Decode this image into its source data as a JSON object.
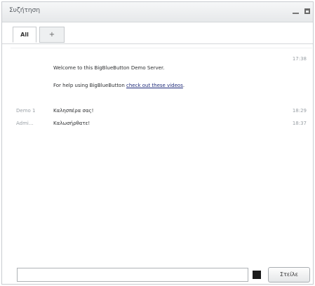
{
  "window": {
    "title": "Συζήτηση"
  },
  "tabs": [
    {
      "label": "All",
      "active": true
    },
    {
      "label": "+",
      "active": false
    }
  ],
  "messages": [
    {
      "name": "",
      "text": "",
      "time": "17:38"
    },
    {
      "name": "",
      "text": "Welcome to this BigBlueButton Demo Server.",
      "time": ""
    },
    {
      "name": "",
      "text_prefix": "For help using BigBlueButton ",
      "link": "check out these videos",
      "text_suffix": ".",
      "time": ""
    },
    {
      "name": "Demo 1",
      "text": "Καλησπέρα σας!",
      "time": "18:29"
    },
    {
      "name": "Admi...",
      "text": "Καλωσήρθατε!",
      "time": "18:37"
    }
  ],
  "composer": {
    "input_value": "",
    "input_placeholder": "",
    "color_swatch": "#1a1a1a",
    "send_label": "Στείλε"
  }
}
